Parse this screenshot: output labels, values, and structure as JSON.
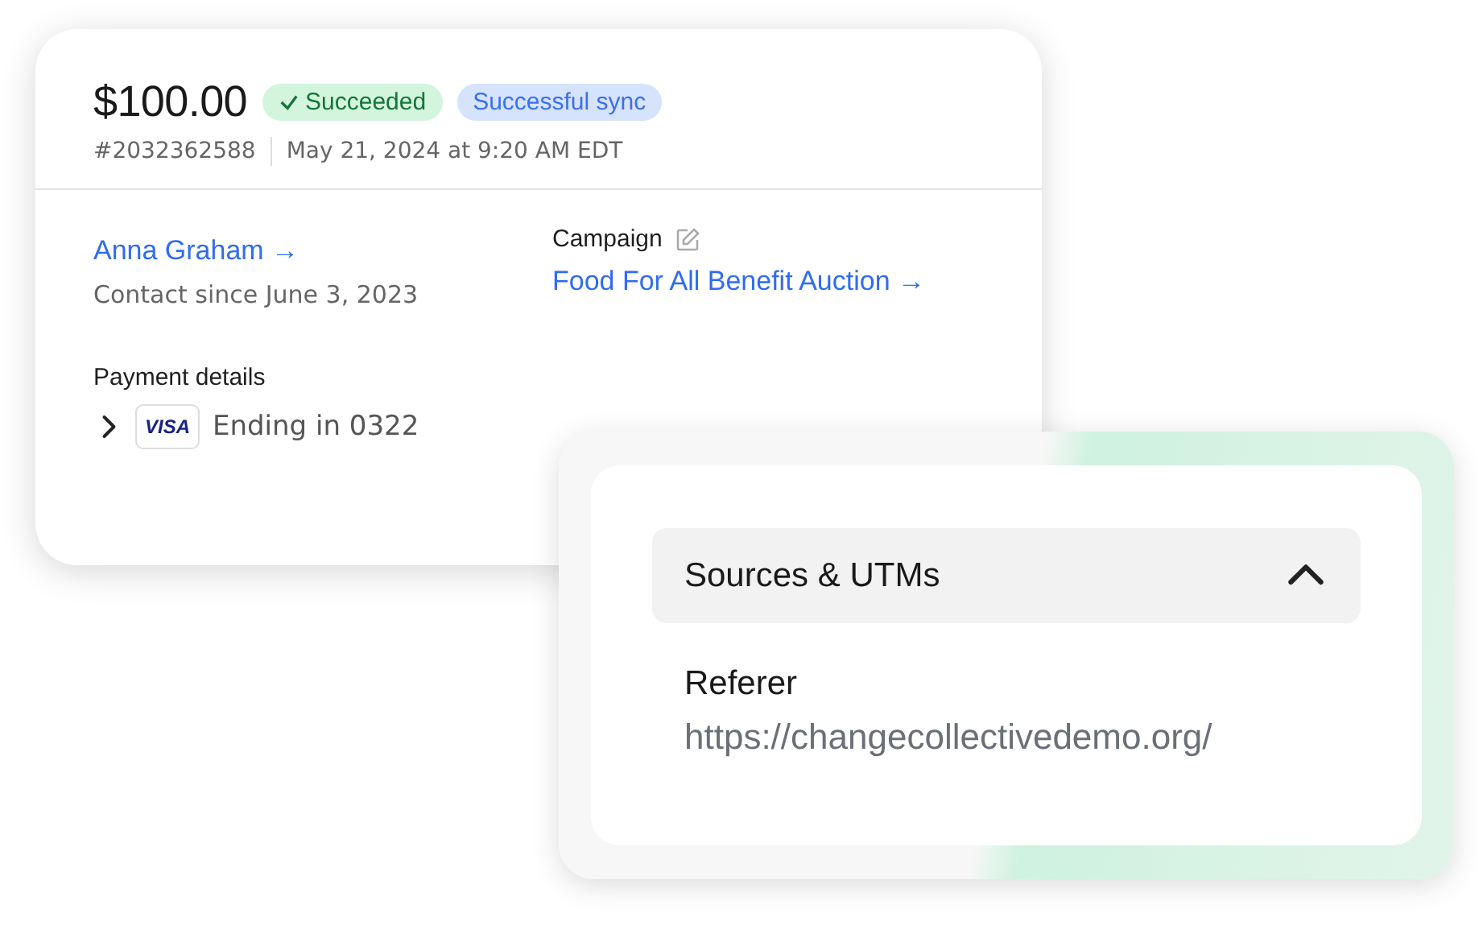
{
  "payment_card": {
    "amount": "$100.00",
    "badges": [
      {
        "label": "Succeeded",
        "kind": "success"
      },
      {
        "label": "Successful sync",
        "kind": "info"
      }
    ],
    "transaction_id": "#2032362588",
    "timestamp": "May 21, 2024 at 9:20 AM EDT",
    "contact": {
      "name": "Anna Graham →",
      "since": "Contact since June 3, 2023"
    },
    "campaign": {
      "label": "Campaign",
      "name": "Food For All Benefit Auction →"
    },
    "payment_details": {
      "label": "Payment details",
      "expanded": false,
      "card_brand": "VISA",
      "card_text": "Ending in 0322"
    }
  },
  "sources_card": {
    "section": {
      "title": "Sources & UTMs",
      "expanded": true,
      "fields": [
        {
          "label": "Referer",
          "value": "https://changecollectivedemo.org/"
        }
      ]
    }
  }
}
